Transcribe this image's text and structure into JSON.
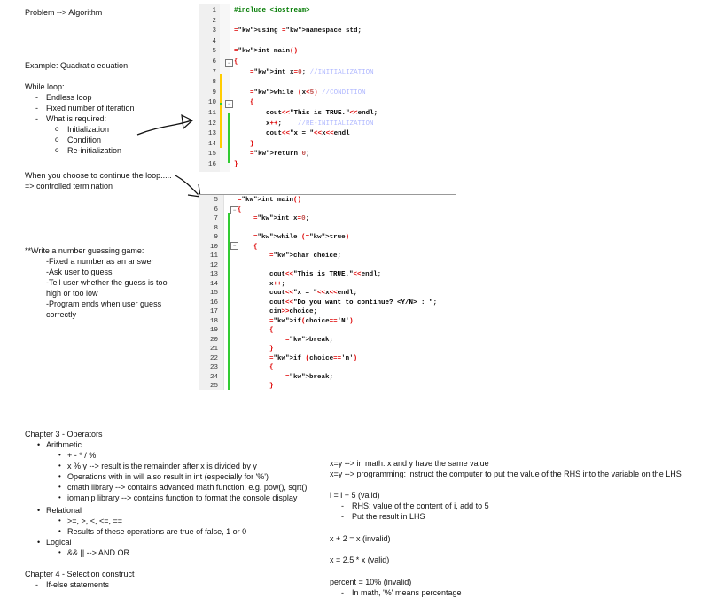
{
  "top_notes": {
    "title": "Problem --> Algorithm",
    "example": "Example: Quadratic equation",
    "while_loop": "While loop:",
    "while_items": [
      "Endless loop",
      "Fixed number of iteration",
      "What is required:"
    ],
    "required_items": [
      "Initialization",
      "Condition",
      "Re-initialization"
    ],
    "continue_line1": "When you choose to continue the loop.....",
    "continue_line2": "=> controlled termination"
  },
  "guess_game": {
    "title": "**Write a number guessing game:",
    "items": [
      "-Fixed a number as an answer",
      "-Ask user to guess",
      "-Tell user whether the guess is too",
      "high or too low",
      "-Program ends when user guess",
      "correctly"
    ]
  },
  "code1": {
    "line_numbers": [
      "1",
      "2",
      "3",
      "4",
      "5",
      "6",
      "7",
      "8",
      "9",
      "10",
      "11",
      "12",
      "13",
      "14",
      "15",
      "16"
    ],
    "lines": [
      "#include <iostream>",
      "",
      "using namespace std;",
      "",
      "int main()",
      "{",
      "    int x=0; //INITIALIZATION",
      "",
      "    while (x<5) //CONDITION",
      "    {",
      "        cout<<\"This is TRUE.\"<<endl;",
      "        x++;    //RE-INITIALIZATION",
      "        cout<<\"x = \"<<x<<endl",
      "    }",
      "    return 0;",
      "}"
    ]
  },
  "code2": {
    "line_numbers": [
      "5",
      "6",
      "7",
      "8",
      "9",
      "10",
      "11",
      "12",
      "13",
      "14",
      "15",
      "16",
      "17",
      "18",
      "19",
      "20",
      "21",
      "22",
      "23",
      "24",
      "25"
    ],
    "lines": [
      "int main()",
      "{",
      "    int x=0;",
      "",
      "    while (true)",
      "    {",
      "        char choice;",
      "",
      "        cout<<\"This is TRUE.\"<<endl;",
      "        x++;",
      "        cout<<\"x = \"<<x<<endl;",
      "        cout<<\"Do you want to continue? <Y/N> : \";",
      "        cin>>choice;",
      "        if(choice=='N')",
      "        {",
      "            break;",
      "        }",
      "        if (choice=='n')",
      "        {",
      "            break;",
      "        }"
    ]
  },
  "chapter3": {
    "title": "Chapter 3 - Operators",
    "arith": "Arithmetic",
    "arith_items": [
      "+ - * / %",
      "x % y --> result is the remainder after x is divided by y",
      "Operations with in will also result in int (especially for '%')",
      "cmath library --> contains advanced math function, e.g. pow(), sqrt()",
      "iomanip library --> contains function to format the console display"
    ],
    "rel": "Relational",
    "rel_items": [
      ">=, >, <, <=, ==",
      "Results of these operations are true of false, 1 or 0"
    ],
    "logical": "Logical",
    "logical_items": [
      "&& || --> AND OR"
    ],
    "chapter4": "Chapter 4 - Selection construct",
    "ifelse": "If-else statements"
  },
  "right_notes": {
    "line1": "x=y --> in math: x and y have the same value",
    "line2": "x=y --> programming: instruct the computer to put the value of the RHS into the variable on the LHS",
    "line3": "i = i + 5 (valid)",
    "rhs_items": [
      "RHS: value of the content of i, add to 5",
      "Put the result in LHS"
    ],
    "line4": "x + 2 = x (invalid)",
    "line5": "x = 2.5 * x (valid)",
    "line6": "percent = 10% (invalid)",
    "line7": "In math, '%' means percentage"
  },
  "colors": {
    "keyword": "#0b0b8a",
    "preprocessor": "#007a00",
    "comment": "#b0b8ff",
    "change_green": "#33cc33",
    "change_yellow": "#ffcc00"
  }
}
